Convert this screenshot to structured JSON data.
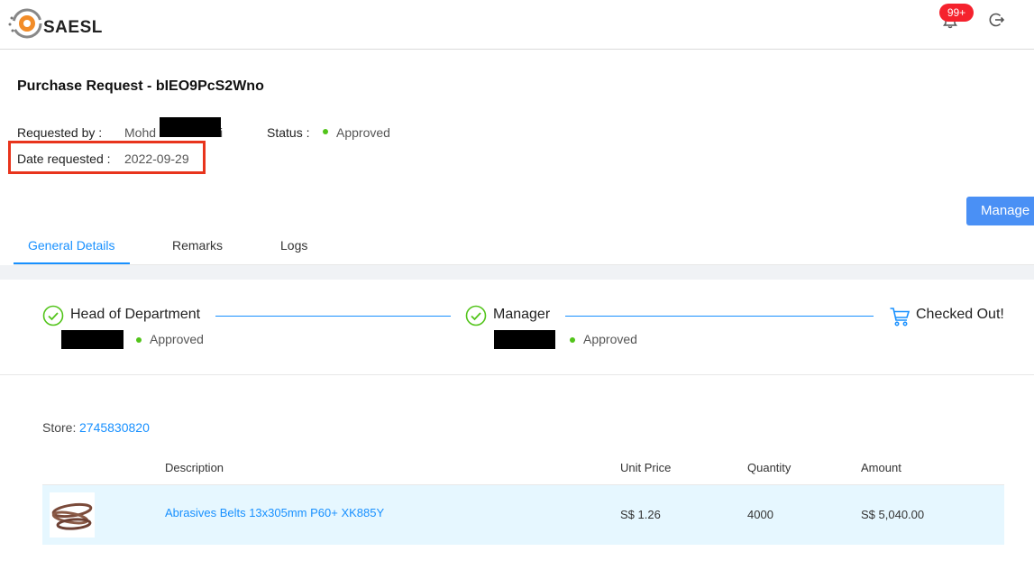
{
  "header": {
    "logo_text": "SAESL",
    "notification_count": "99+"
  },
  "request": {
    "title": "Purchase Request - bIEO9PcS2Wno",
    "requested_by_label": "Requested by :",
    "requested_by_value": "Mohd",
    "requested_by_suffix": "i",
    "status_label": "Status :",
    "status_value": "Approved",
    "date_label": "Date requested :",
    "date_value": "2022-09-29"
  },
  "actions": {
    "manage_label": "Manage"
  },
  "tabs": [
    {
      "label": "General Details",
      "active": true
    },
    {
      "label": "Remarks",
      "active": false
    },
    {
      "label": "Logs",
      "active": false
    }
  ],
  "approval_steps": [
    {
      "title": "Head of Department",
      "status": "Approved",
      "icon": "check-circle-icon"
    },
    {
      "title": "Manager",
      "status": "Approved",
      "icon": "check-circle-icon"
    },
    {
      "title": "Checked Out!",
      "status": "",
      "icon": "shopping-cart-icon"
    }
  ],
  "store": {
    "label": "Store:",
    "id": "2745830820"
  },
  "table": {
    "columns": [
      "",
      "Description",
      "Unit Price",
      "Quantity",
      "Amount"
    ],
    "rows": [
      {
        "description": "Abrasives Belts 13x305mm P60+ XK885Y",
        "unit_price": "S$ 1.26",
        "quantity": "4000",
        "amount": "S$ 5,040.00"
      }
    ]
  },
  "colors": {
    "accent": "#1890ff",
    "manage_button": "#4a90f5",
    "approved_dot": "#52c41a",
    "highlight_box": "#e8341c",
    "badge": "#f5222d",
    "row_highlight": "#e6f7ff"
  }
}
